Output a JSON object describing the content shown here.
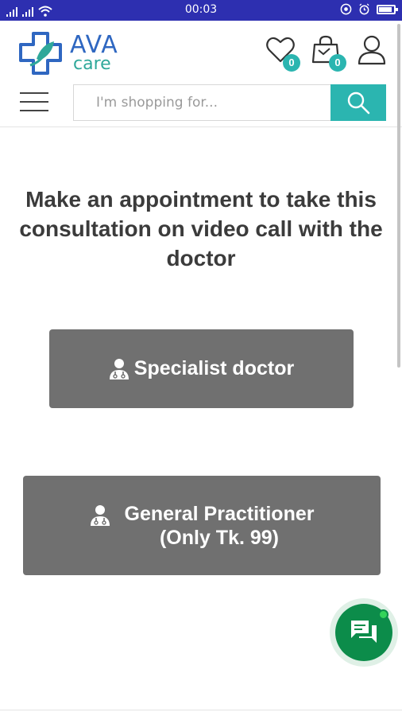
{
  "status_bar": {
    "time": "00:03",
    "battery_level": 0.8
  },
  "header": {
    "logo": {
      "brand": "AVA",
      "sub": "care"
    },
    "wishlist_count": "0",
    "cart_count": "0",
    "search": {
      "placeholder": "I'm shopping for..."
    }
  },
  "main": {
    "heading": "Make an appointment to take this consultation on video call with the doctor",
    "specialist_button": {
      "label": "Specialist doctor"
    },
    "gp_button": {
      "line1": "General Practitioner",
      "line2": "(Only Tk. 99)"
    }
  },
  "colors": {
    "status_bar": "#2d2fb0",
    "accent": "#2bb5b0",
    "button": "#707070",
    "chat": "#0c8c4a"
  },
  "icons": [
    "signal-icon",
    "wifi-icon",
    "vpn-icon",
    "alarm-icon",
    "battery-icon",
    "heart-icon",
    "cart-icon",
    "user-icon",
    "menu-icon",
    "search-icon",
    "doctor-icon",
    "chat-icon"
  ]
}
